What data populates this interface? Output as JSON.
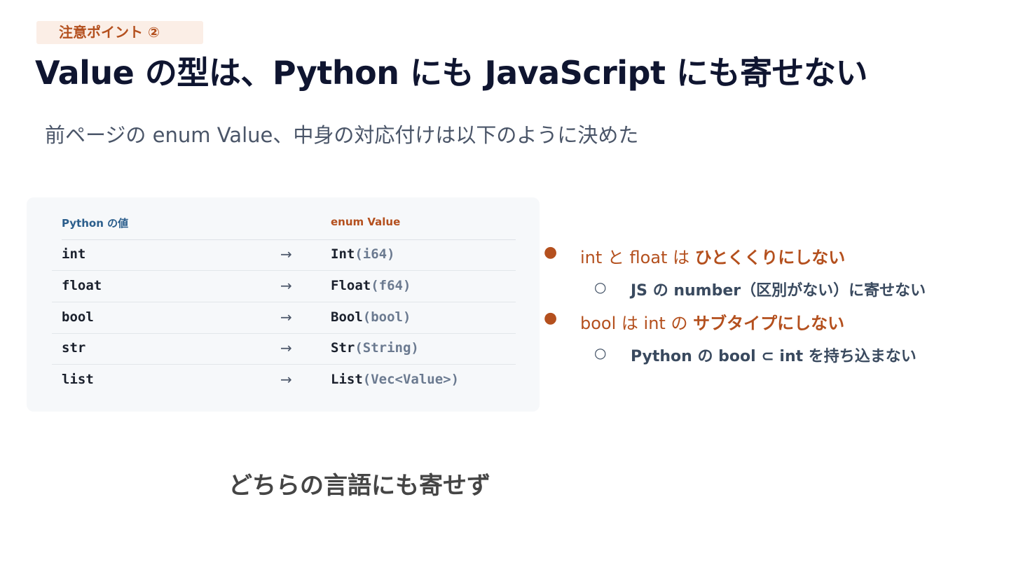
{
  "badge": "注意ポイント ②",
  "title": "Value の型は、Python にも JavaScript にも寄せない",
  "subtitle": "前ページの enum Value、中身の対応付けは以下のように決めた",
  "table": {
    "headers": {
      "python": "Python の値",
      "enum": "enum Value"
    },
    "rows": [
      {
        "python": "int",
        "arrow": "→",
        "ctor": "Int",
        "inner": "(i64)"
      },
      {
        "python": "float",
        "arrow": "→",
        "ctor": "Float",
        "inner": "(f64)"
      },
      {
        "python": "bool",
        "arrow": "→",
        "ctor": "Bool",
        "inner": "(bool)"
      },
      {
        "python": "str",
        "arrow": "→",
        "ctor": "Str",
        "inner": "(String)"
      },
      {
        "python": "list",
        "arrow": "→",
        "ctor": "List",
        "inner": "(Vec<Value>)"
      }
    ]
  },
  "bullets": [
    {
      "bullet": "●",
      "prefix": "int と float は ",
      "emphasis": "ひとくくりにしない",
      "sub": {
        "bullet": "○",
        "text": "JS の number（区別がない）に寄せない"
      }
    },
    {
      "bullet": "●",
      "prefix": "bool は int の ",
      "emphasis": "サブタイプにしない",
      "sub": {
        "bullet": "○",
        "text": "Python の bool ⊂ int を持ち込まない"
      }
    }
  ],
  "footer": "どちらの言語にも寄せず",
  "colors": {
    "accent": "#b4501e",
    "title": "#0f1530",
    "header_python": "#2b5e8c"
  }
}
